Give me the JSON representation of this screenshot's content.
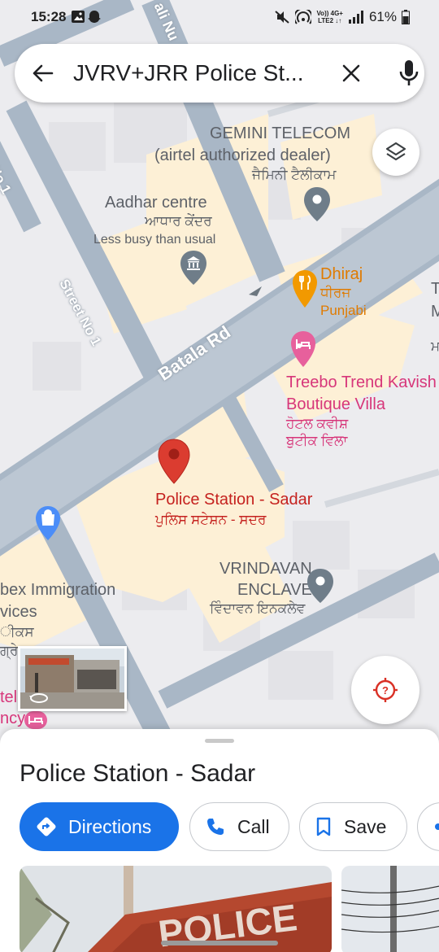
{
  "status_bar": {
    "time": "15:28",
    "network_top": "Vo)) 4G+",
    "network_bottom": "LTE2 ↓↑",
    "battery": "61%"
  },
  "search": {
    "query": "JVRV+JRR Police St..."
  },
  "map": {
    "roads": {
      "batala": "Batala Rd",
      "street1": "Street No 1",
      "no1_left": "No 1",
      "top_road": "ali Nu"
    },
    "pois": {
      "gemini_line1": "GEMINI TELECOM",
      "gemini_line2": "(airtel authorized dealer)",
      "gemini_line3": "ਜੈਮਿਨੀ ਟੈਲੀਕਾਮ",
      "aadhar_line1": "Aadhar centre",
      "aadhar_line2": "ਆਧਾਰ ਕੇਂਦਰ",
      "aadhar_line3": "Less busy than usual",
      "dhiraj_line1": "Dhiraj",
      "dhiraj_line2": "ਧੀਰਜ",
      "dhiraj_line3": "Punjabi",
      "treebo_line1": "Treebo Trend Kavish",
      "treebo_line2": "Boutique Villa",
      "treebo_line3": "ਹੋਟਲ ਕਵੀਸ਼",
      "treebo_line4": "ਬੁਟੀਕ ਵਿਲਾ",
      "police_line1": "Police Station - Sadar",
      "police_line2": "ਪੁਲਿਸ ਸਟੇਸ਼ਨ - ਸਦਰ",
      "vrindavan_line1": "VRINDAVAN",
      "vrindavan_line2": "ENCLAVE",
      "vrindavan_line3": "ਵਿੰਦਾਵਨ ਇਨਕਲੇਵ",
      "immigration_line1": "bex Immigration",
      "immigration_line2": "vices",
      "immigration_line3": "ੀਕਸ",
      "immigration_line4": "ਗ੍ਰੇਸ਼",
      "hotel_line1": "tel",
      "hotel_line2": "ncy",
      "edge_line1": "T",
      "edge_line2": "M",
      "edge_line3": "ਮ"
    },
    "colors": {
      "road": "#a9b7c6",
      "building": "#fdf0d6",
      "red_pin": "#db3c30",
      "pink": "#d7367a",
      "orange": "#f29900"
    }
  },
  "place": {
    "name": "Police Station - Sadar",
    "actions": {
      "directions": "Directions",
      "call": "Call",
      "save": "Save"
    },
    "photo_sign_text": "POLICE"
  },
  "colors": {
    "accent": "#1a73e8"
  }
}
